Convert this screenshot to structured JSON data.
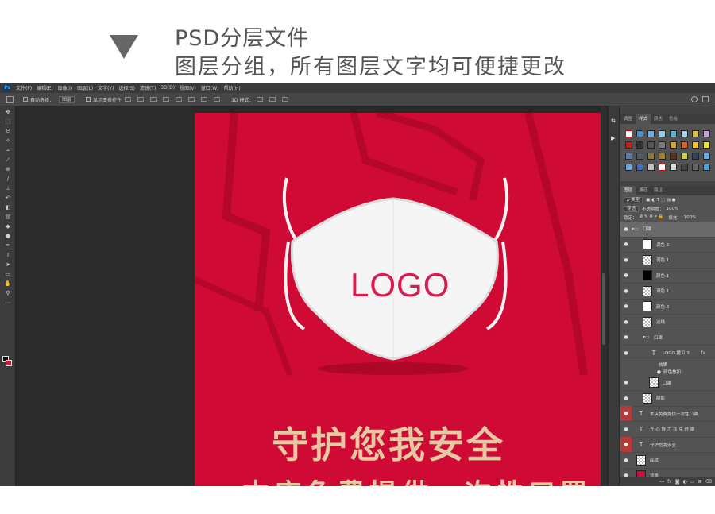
{
  "banner": {
    "line1": "PSD分层文件",
    "line2": "图层分组，所有图层文字均可便捷更改"
  },
  "app": {
    "logo": "Ps",
    "menu": [
      "文件(F)",
      "编辑(E)",
      "图像(I)",
      "图层(L)",
      "文字(Y)",
      "选择(S)",
      "滤镜(T)",
      "3D(D)",
      "视图(V)",
      "窗口(W)",
      "帮助(H)"
    ]
  },
  "options": {
    "auto_select_label": "自动选择：",
    "auto_select_value": "图层",
    "show_transform_label": "显示变换控件",
    "mode_3d_label": "3D 模式："
  },
  "canvas": {
    "logo_text": "LOGO",
    "slogan": "守护您我安全",
    "slogan2": "本店免费提供一次性口罩"
  },
  "styles_panel": {
    "tabs": [
      "调整",
      "样式",
      "颜色",
      "色板"
    ],
    "active_tab": "样式"
  },
  "layers_panel": {
    "tabs": [
      "图层",
      "通道",
      "路径"
    ],
    "filter_label": "ρ 类型",
    "blend_mode": "穿透",
    "opacity_label": "不透明度：",
    "opacity_value": "100%",
    "lock_label": "锁定：",
    "fill_label": "填充：",
    "fill_value": "100%",
    "layers": [
      {
        "name": "口罩",
        "kind": "group"
      },
      {
        "name": "调色 2",
        "kind": "raster"
      },
      {
        "name": "调色 1",
        "kind": "raster"
      },
      {
        "name": "颜色 1",
        "kind": "raster"
      },
      {
        "name": "调色 1",
        "kind": "raster"
      },
      {
        "name": "颜色 3",
        "kind": "raster"
      },
      {
        "name": "边线",
        "kind": "raster"
      },
      {
        "name": "口罩",
        "kind": "group"
      },
      {
        "name": "LOGO 拷贝 3",
        "kind": "text"
      },
      {
        "name": "效果",
        "kind": "sub"
      },
      {
        "name": "颜色叠加",
        "kind": "sub"
      },
      {
        "name": "口罩",
        "kind": "raster"
      },
      {
        "name": "阴影",
        "kind": "raster"
      },
      {
        "name": "本店免费提供一次性口罩",
        "kind": "text"
      },
      {
        "name": "齐 心 协 力 共 克 时 艰",
        "kind": "text"
      },
      {
        "name": "守护您我安全",
        "kind": "text"
      },
      {
        "name": "底纹",
        "kind": "raster"
      },
      {
        "name": "背景",
        "kind": "raster"
      }
    ],
    "footer_fx": "fx"
  },
  "colors": {
    "doc_background": "#cf0a34",
    "logo_text": "#d91b4d",
    "slogan": "#e6c9a2"
  }
}
